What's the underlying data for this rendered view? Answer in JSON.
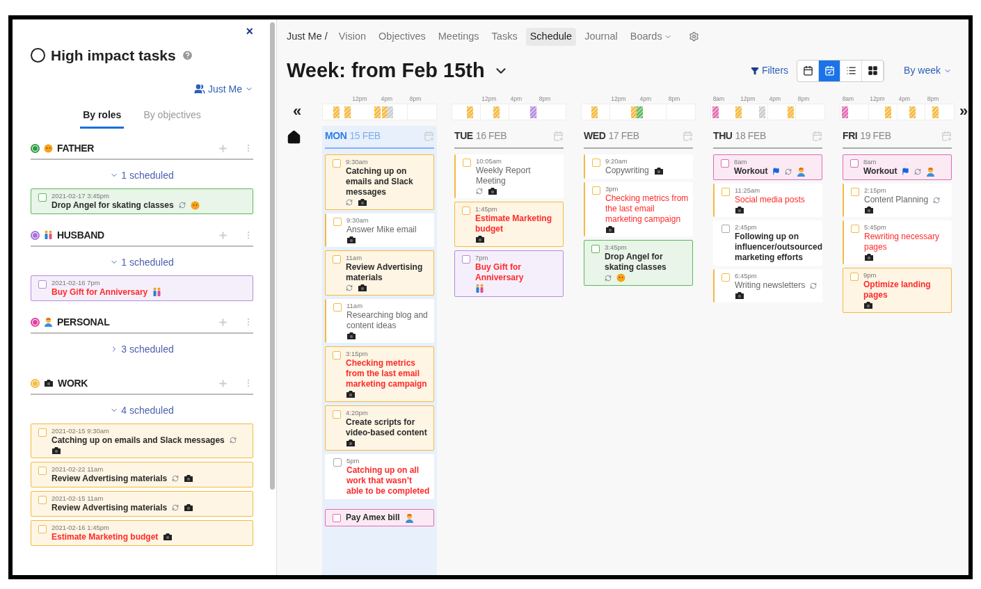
{
  "sidebar": {
    "close": "×",
    "title": "High impact tasks",
    "owner": "Just Me",
    "tabs": [
      {
        "label": "By roles",
        "selected": true
      },
      {
        "label": "By objectives",
        "selected": false
      }
    ],
    "roles": [
      {
        "name": "FATHER",
        "color": "#2e9b3e",
        "kind": "father",
        "scheduled": "1 scheduled",
        "expanded": true,
        "tasks": [
          {
            "date": "2021-02-17 3:45pm",
            "title": "Drop Angel for skating classes",
            "important": true,
            "urgent": false,
            "filled": true,
            "color": "#5cb85c",
            "kind": "father",
            "recurring": true,
            "flagged": false
          }
        ]
      },
      {
        "name": "HUSBAND",
        "color": "#a56fd9",
        "kind": "husband",
        "scheduled": "1 scheduled",
        "expanded": true,
        "tasks": [
          {
            "date": "2021-02-16 7pm",
            "title": "Buy Gift for Anniversary",
            "important": true,
            "urgent": true,
            "filled": true,
            "color": "#b48be0",
            "kind": "husband",
            "recurring": false,
            "flagged": false
          }
        ]
      },
      {
        "name": "PERSONAL",
        "color": "#e23fa0",
        "kind": "personal",
        "scheduled": "3 scheduled",
        "expanded": false
      },
      {
        "name": "WORK",
        "color": "#f5b93f",
        "kind": "work",
        "scheduled": "4 scheduled",
        "expanded": true,
        "tasks": [
          {
            "date": "2021-02-15 9:30am",
            "title": "Catching up on emails and Slack messages",
            "important": true,
            "urgent": false,
            "filled": true,
            "color": "#f5b93f",
            "kind": "work",
            "recurring": true,
            "flagged": false
          },
          {
            "date": "2021-02-22 11am",
            "title": "Review Advertising materials",
            "important": true,
            "urgent": false,
            "filled": true,
            "color": "#f5b93f",
            "kind": "work",
            "recurring": true,
            "flagged": false
          },
          {
            "date": "2021-02-15 11am",
            "title": "Review Advertising materials",
            "important": true,
            "urgent": false,
            "filled": true,
            "color": "#f5b93f",
            "kind": "work",
            "recurring": true,
            "flagged": false
          },
          {
            "date": "2021-02-16 1:45pm",
            "title": "Estimate Marketing budget",
            "important": true,
            "urgent": true,
            "filled": true,
            "color": "#f5b93f",
            "kind": "work",
            "recurring": false,
            "flagged": false
          }
        ]
      }
    ]
  },
  "nav": {
    "breadcrumb": "Just Me /",
    "items": [
      {
        "label": "Vision",
        "selected": false,
        "has_menu": false
      },
      {
        "label": "Objectives",
        "selected": false,
        "has_menu": false
      },
      {
        "label": "Meetings",
        "selected": false,
        "has_menu": false
      },
      {
        "label": "Tasks",
        "selected": false,
        "has_menu": false
      },
      {
        "label": "Schedule",
        "selected": true,
        "has_menu": false
      },
      {
        "label": "Journal",
        "selected": false,
        "has_menu": false
      },
      {
        "label": "Boards",
        "selected": false,
        "has_menu": true
      }
    ]
  },
  "header": {
    "title": "Week: from Feb 15th",
    "filters": "Filters",
    "views": [
      {
        "kind": "month",
        "selected": false
      },
      {
        "kind": "week",
        "selected": true
      },
      {
        "kind": "list",
        "selected": false
      },
      {
        "kind": "board",
        "selected": false
      }
    ],
    "period": "By week"
  },
  "prev": "«",
  "next": "»",
  "days": [
    {
      "weekday": "MON",
      "date": "15 FEB",
      "selected": true,
      "ticks": [
        "12pm",
        "4pm",
        "8pm"
      ],
      "tasks": [
        {
          "time": "9:30am",
          "title": "Catching up on emails and Slack messages",
          "important": true,
          "urgent": false,
          "filled": true,
          "color": "#f5b93f",
          "kind": "work",
          "recurring": true,
          "flagged": false
        },
        {
          "time": "9:30am",
          "title": "Answer Mike email",
          "important": false,
          "urgent": false,
          "filled": false,
          "color": "#f5b93f",
          "kind": "work",
          "recurring": false,
          "flagged": false
        },
        {
          "time": "11am",
          "title": "Review Advertising materials",
          "important": true,
          "urgent": false,
          "filled": true,
          "color": "#f5b93f",
          "kind": "work",
          "recurring": true,
          "flagged": false
        },
        {
          "time": "11am",
          "title": "Researching blog and content ideas",
          "important": false,
          "urgent": false,
          "filled": false,
          "color": "#f5b93f",
          "kind": "work",
          "recurring": false,
          "flagged": false
        },
        {
          "time": "3:15pm",
          "title": "Checking metrics from the last email marketing campaign",
          "important": true,
          "urgent": true,
          "filled": true,
          "color": "#f5b93f",
          "kind": "work",
          "recurring": false,
          "flagged": false
        },
        {
          "time": "4:20pm",
          "title": "Create scripts for video-based content",
          "important": true,
          "urgent": false,
          "filled": true,
          "color": "#f5b93f",
          "kind": "work",
          "recurring": false,
          "flagged": false
        },
        {
          "time": "5pm",
          "title": "Catching up on all work that wasn’t able to be completed",
          "important": true,
          "urgent": true,
          "filled": false,
          "recurring": false,
          "flagged": false
        }
      ],
      "unscheduled": [
        {
          "title": "Pay Amex bill",
          "important": true,
          "urgent": false,
          "filled": true,
          "color": "#e26bb0",
          "kind": "personal",
          "recurring": false,
          "flagged": false
        }
      ]
    },
    {
      "weekday": "TUE",
      "date": "16 FEB",
      "selected": false,
      "ticks": [
        "12pm",
        "4pm",
        "8pm"
      ],
      "tasks": [
        {
          "time": "10:05am",
          "title": "Weekly Report Meeting",
          "important": false,
          "urgent": false,
          "filled": false,
          "color": "#f5b93f",
          "kind": "work",
          "recurring": true,
          "flagged": false
        },
        {
          "time": "1:45pm",
          "title": "Estimate Marketing budget",
          "important": true,
          "urgent": true,
          "filled": true,
          "color": "#f5b93f",
          "kind": "work",
          "recurring": false,
          "flagged": false
        },
        {
          "time": "7pm",
          "title": "Buy Gift for Anniversary",
          "important": true,
          "urgent": true,
          "filled": true,
          "color": "#b48be0",
          "kind": "husband",
          "recurring": false,
          "flagged": false
        }
      ]
    },
    {
      "weekday": "WED",
      "date": "17 FEB",
      "selected": false,
      "ticks": [
        "12pm",
        "4pm",
        "8pm"
      ],
      "tasks": [
        {
          "time": "9:20am",
          "title": "Copywriting",
          "important": false,
          "urgent": false,
          "filled": false,
          "color": "#f5b93f",
          "kind": "work",
          "recurring": false,
          "flagged": false
        },
        {
          "time": "3pm",
          "title": "Checking metrics from the last email marketing campaign",
          "important": false,
          "urgent": true,
          "filled": false,
          "color": "#f5b93f",
          "kind": "work",
          "recurring": false,
          "flagged": false
        },
        {
          "time": "3:45pm",
          "title": "Drop Angel for skating classes",
          "important": true,
          "urgent": false,
          "filled": true,
          "color": "#5cb85c",
          "kind": "father",
          "recurring": true,
          "flagged": false
        }
      ]
    },
    {
      "weekday": "THU",
      "date": "18 FEB",
      "selected": false,
      "ticks": [
        "8am",
        "12pm",
        "4pm",
        "8pm"
      ],
      "tasks": [
        {
          "time": "8am",
          "title": "Workout",
          "important": true,
          "urgent": false,
          "filled": true,
          "color": "#e26bb0",
          "kind": "personal",
          "recurring": true,
          "flagged": true
        },
        {
          "time": "11:25am",
          "title": "Social media posts",
          "important": false,
          "urgent": true,
          "filled": false,
          "color": "#f5b93f",
          "kind": "work",
          "recurring": false,
          "flagged": false
        },
        {
          "time": "2:45pm",
          "title": "Following up on influencer/outsourced marketing efforts",
          "important": true,
          "urgent": false,
          "filled": false,
          "recurring": false,
          "flagged": false
        },
        {
          "time": "6:45pm",
          "title": "Writing newsletters",
          "important": false,
          "urgent": false,
          "filled": false,
          "color": "#f5b93f",
          "kind": "work",
          "recurring": true,
          "flagged": false
        }
      ]
    },
    {
      "weekday": "FRI",
      "date": "19 FEB",
      "selected": false,
      "ticks": [
        "8am",
        "12pm",
        "4pm",
        "8pm"
      ],
      "tasks": [
        {
          "time": "8am",
          "title": "Workout",
          "important": true,
          "urgent": false,
          "filled": true,
          "color": "#e26bb0",
          "kind": "personal",
          "recurring": true,
          "flagged": true
        },
        {
          "time": "2:15pm",
          "title": "Content Planning",
          "important": false,
          "urgent": false,
          "filled": false,
          "color": "#f5b93f",
          "kind": "work",
          "recurring": true,
          "flagged": false
        },
        {
          "time": "5:45pm",
          "title": "Rewriting necessary pages",
          "important": false,
          "urgent": true,
          "filled": false,
          "color": "#f5b93f",
          "kind": "work",
          "recurring": false,
          "flagged": false
        },
        {
          "time": "9pm",
          "title": "Optimize landing pages",
          "important": true,
          "urgent": true,
          "filled": true,
          "color": "#f5b93f",
          "kind": "work",
          "recurring": false,
          "flagged": false
        }
      ]
    }
  ]
}
